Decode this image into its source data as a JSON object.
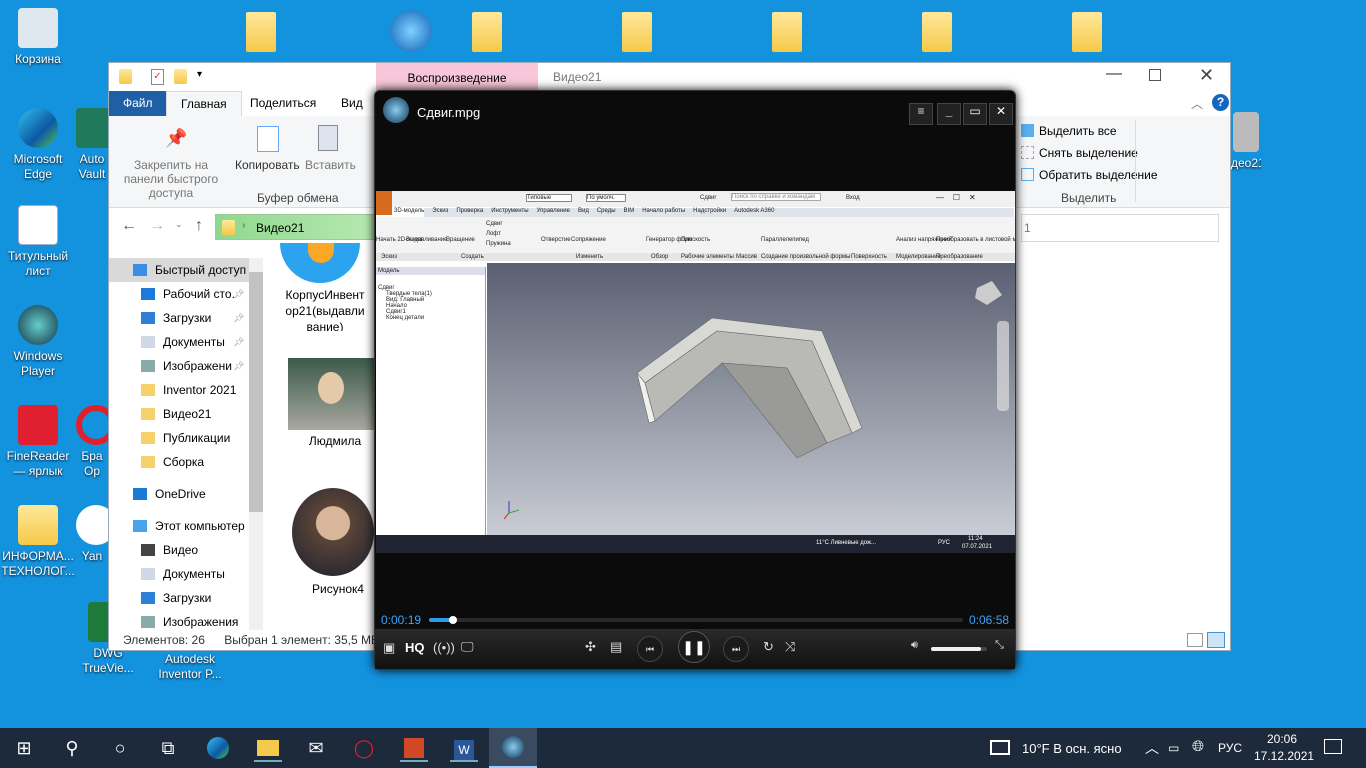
{
  "desktop": {
    "icons": [
      {
        "label": "Корзина"
      },
      {
        "label": "Microsoft Edge"
      },
      {
        "label": "Auto Vault"
      },
      {
        "label": "Титульный лист"
      },
      {
        "label": "Windows Player"
      },
      {
        "label": "FineReader — ярлык"
      },
      {
        "label": "Бра Op"
      },
      {
        "label": "ИНФОРМА... ТЕХНОЛОГ..."
      },
      {
        "label": "Yan"
      },
      {
        "label": "DWG TrueVie..."
      },
      {
        "label": "Autodesk Inventor P..."
      },
      {
        "label": "део21"
      }
    ]
  },
  "explorer": {
    "context_tab": "Воспроизведение",
    "title": "Видео21",
    "tabs": [
      "Файл",
      "Главная",
      "Поделиться",
      "Вид"
    ],
    "ribbon": {
      "pin": "Закрепить на панели быстрого доступа",
      "copy": "Копировать",
      "paste": "Вставить",
      "clipboard_group": "Буфер обмена",
      "select_all": "Выделить все",
      "deselect": "Снять выделение",
      "invert": "Обратить выделение",
      "select_group": "Выделить"
    },
    "address": "Видео21",
    "search_tail": "1",
    "nav": [
      {
        "label": "Быстрый доступ",
        "icon": "star-icon"
      },
      {
        "label": "Рабочий сто.",
        "icon": "desktop-icon",
        "pinned": true
      },
      {
        "label": "Загрузки",
        "icon": "download-icon",
        "pinned": true
      },
      {
        "label": "Документы",
        "icon": "document-icon",
        "pinned": true
      },
      {
        "label": "Изображени",
        "icon": "image-icon",
        "pinned": true
      },
      {
        "label": "Inventor 2021",
        "icon": "folder-icon"
      },
      {
        "label": "Видео21",
        "icon": "folder-icon"
      },
      {
        "label": "Публикации",
        "icon": "folder-icon"
      },
      {
        "label": "Сборка",
        "icon": "folder-icon"
      },
      {
        "label": "OneDrive",
        "icon": "cloud-icon"
      },
      {
        "label": "Этот компьютер",
        "icon": "computer-icon"
      },
      {
        "label": "Видео",
        "icon": "video-icon"
      },
      {
        "label": "Документы",
        "icon": "document-icon"
      },
      {
        "label": "Загрузки",
        "icon": "download-icon"
      },
      {
        "label": "Изображения",
        "icon": "image-icon"
      }
    ],
    "files": [
      {
        "label": "КорпусИнвентор21(выдавливание)"
      },
      {
        "label": "Людмила"
      },
      {
        "label": "Рисунок4"
      }
    ],
    "status": {
      "count": "Элементов: 26",
      "selected": "Выбран 1 элемент: 35,5 МБ"
    }
  },
  "player": {
    "title": "Сдвиг.mpg",
    "time_current": "0:00:19",
    "time_total": "0:06:58",
    "progress_percent": 4.5,
    "volume_percent": 90,
    "hq_label": "HQ",
    "video": {
      "tab": "Сдвиг",
      "search": "Поиск по справке и командам",
      "login": "Вход",
      "style": "Типовые",
      "default": "По умолч.",
      "menu": [
        "3D-модель",
        "Эскиз",
        "Проверка",
        "Инструменты",
        "Управление",
        "Вид",
        "Среды",
        "BIM",
        "Начало работы",
        "Надстройки",
        "Autodesk A360"
      ],
      "tools": [
        "Начать 2D-эскиз",
        "Выдавливание",
        "Вращение",
        "Сдвиг",
        "Лофт",
        "Пружина",
        "Отверстие",
        "Сопряжение",
        "Генератор форм",
        "Плоскость",
        "Параллелепипед",
        "Анализ напряжений",
        "Преобразовать в листовой металл"
      ],
      "groups": [
        "Эскиз",
        "Создать",
        "Изменить",
        "Обзор",
        "Рабочие элементы",
        "Массив",
        "Создание произвольной формы",
        "Поверхность",
        "Моделирование",
        "Преобразование"
      ],
      "tree_title": "Модель",
      "tree": [
        "Сдвиг",
        "Твердые тела(1)",
        "Вид: Главный",
        "Начало",
        "Сдвиг1",
        "Конец детали"
      ],
      "weather": "11°C Ливневые дож...",
      "lang": "РУС",
      "time": "11:24",
      "date": "07.07.2021"
    }
  },
  "taskbar": {
    "weather": "10°F  В осн. ясно",
    "lang": "РУС",
    "time": "20:06",
    "date": "17.12.2021"
  },
  "colors": {
    "desktop": "#1392de",
    "taskbar": "#1d2a3c",
    "file_tab": "#1f5fa6",
    "context_tab": "#f7c6d9",
    "progress": "#2d9be8"
  }
}
